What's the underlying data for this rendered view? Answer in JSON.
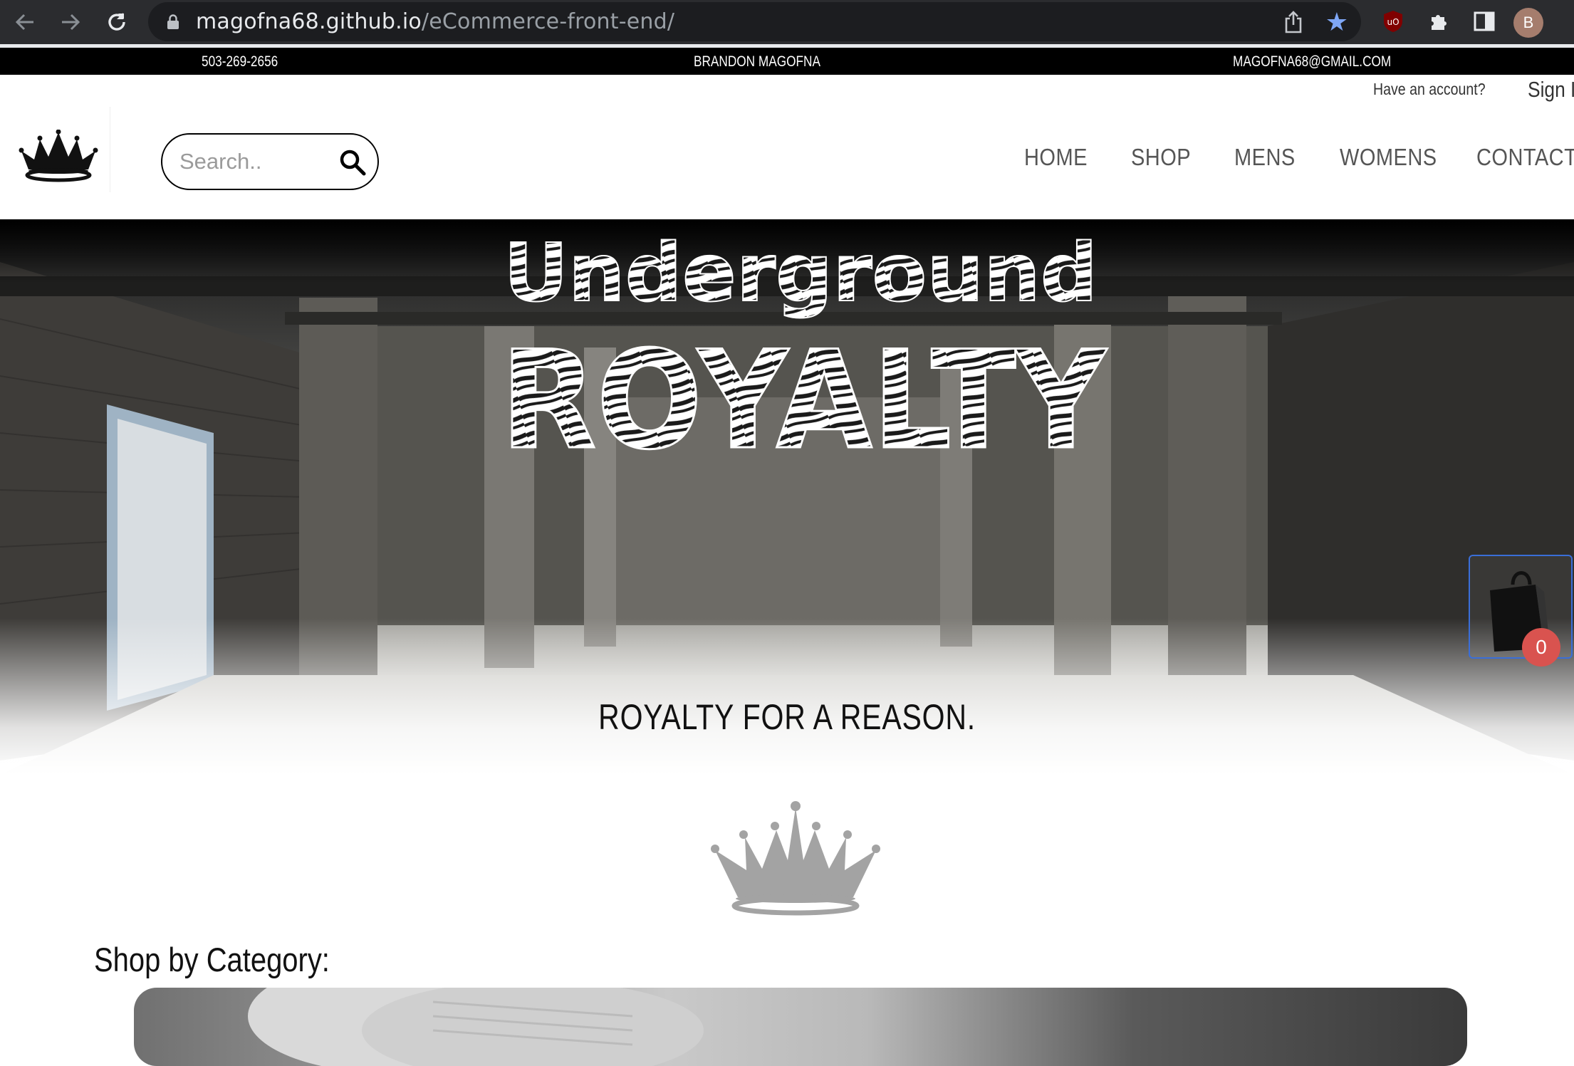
{
  "browser": {
    "url_host": "magofna68.github.io",
    "url_path": "/eCommerce-front-end/",
    "profile_initial": "B"
  },
  "infobar": {
    "phone": "503-269-2656",
    "name": "BRANDON MAGOFNA",
    "email": "MAGOFNA68@GMAIL.COM"
  },
  "account": {
    "prompt": "Have an account?",
    "sign_in": "Sign I"
  },
  "search": {
    "placeholder": "Search.."
  },
  "nav": {
    "home": "HOME",
    "shop": "SHOP",
    "mens": "MENS",
    "womens": "WOMENS",
    "contact": "CONTACT"
  },
  "hero": {
    "title_line1": "Underground",
    "title_line2": "ROYALTY",
    "tagline": "ROYALTY FOR A REASON."
  },
  "cart": {
    "count": "0"
  },
  "sections": {
    "shop_by_category": "Shop by Category:"
  },
  "icons": {
    "back": "back-arrow-icon",
    "forward": "forward-arrow-icon",
    "reload": "reload-icon",
    "lock": "lock-icon",
    "share": "share-icon",
    "bookmark": "star-icon",
    "extension_ublock": "ublock-icon",
    "extensions": "puzzle-icon",
    "sidepanel": "side-panel-icon",
    "logo": "crown-icon",
    "search": "search-icon",
    "cart": "shopping-bag-icon"
  },
  "colors": {
    "chrome_bg": "#2b2c2f",
    "bookmark_star": "#7ea6f5",
    "cart_border": "#3a6ed8",
    "cart_badge": "#d9534f",
    "crown_gray": "#a3a3a3"
  }
}
